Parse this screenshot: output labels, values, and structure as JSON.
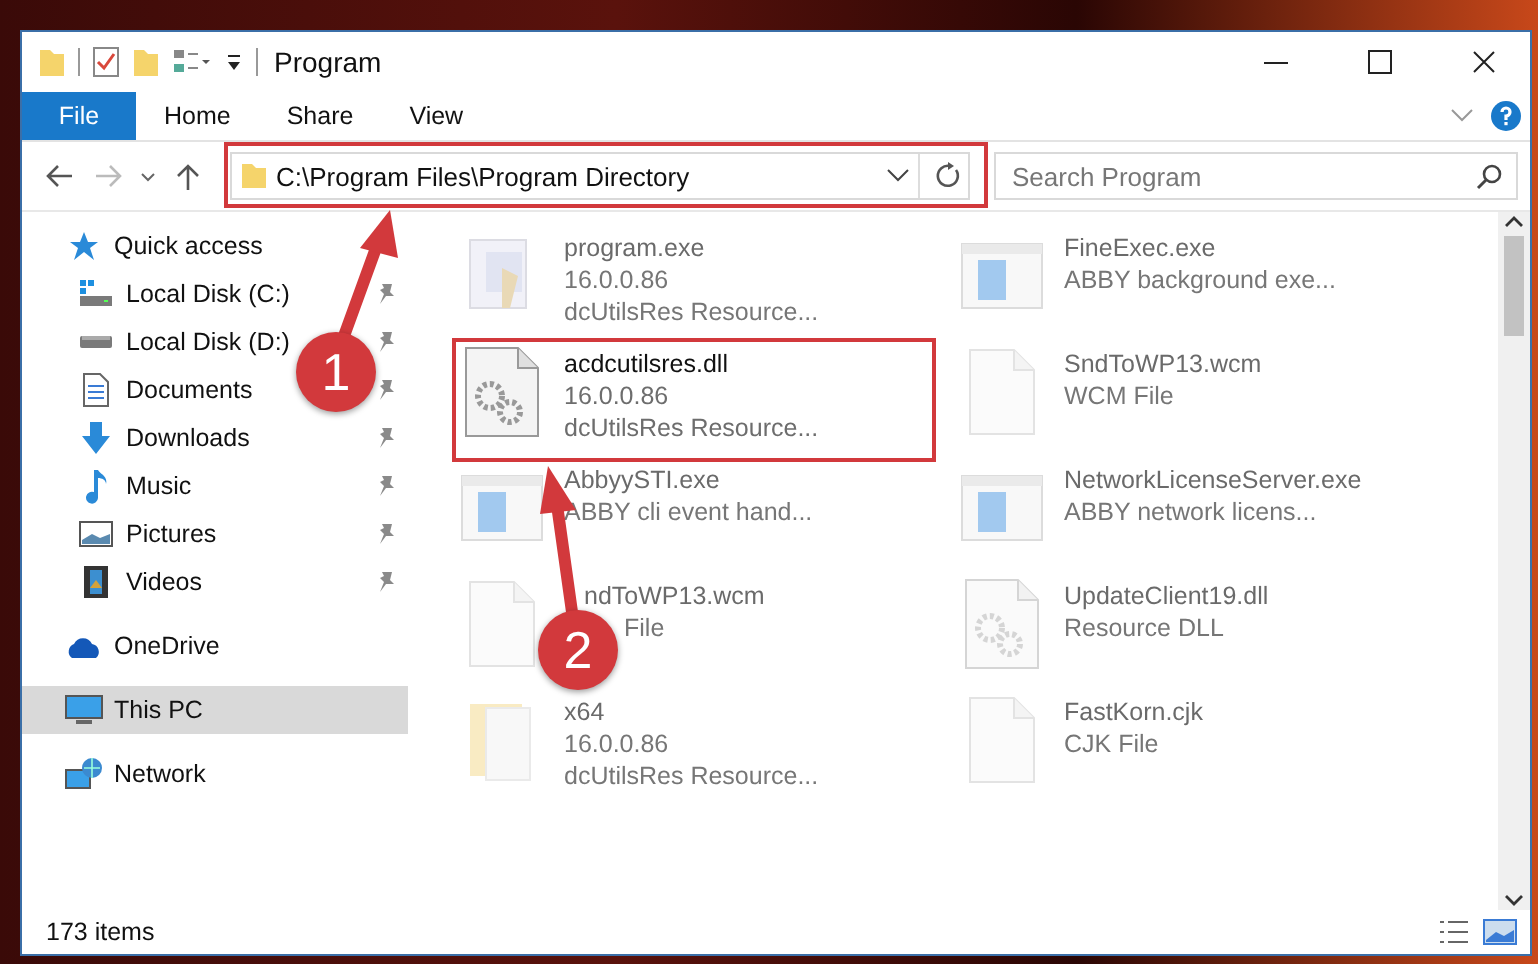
{
  "window": {
    "title": "Program"
  },
  "ribbon_tabs": [
    {
      "label": "File",
      "kind": "file"
    },
    {
      "label": "Home",
      "kind": "tab"
    },
    {
      "label": "Share",
      "kind": "tab"
    },
    {
      "label": "View",
      "kind": "tab"
    }
  ],
  "address_bar": {
    "path": "C:\\Program Files\\Program Directory"
  },
  "search": {
    "placeholder": "Search Program"
  },
  "nav": [
    {
      "label": "Quick access",
      "kind": "star",
      "selected": false,
      "children": [
        {
          "label": "Local Disk (C:)",
          "kind": "system-drive",
          "pinned": true,
          "selected": false
        },
        {
          "label": "Local Disk (D:)",
          "kind": "drive",
          "pinned": true,
          "selected": false
        },
        {
          "label": "Documents",
          "kind": "documents",
          "pinned": true,
          "selected": false
        },
        {
          "label": "Downloads",
          "kind": "downloads",
          "pinned": true,
          "selected": false
        },
        {
          "label": "Music",
          "kind": "music",
          "pinned": true,
          "selected": false
        },
        {
          "label": "Pictures",
          "kind": "pictures",
          "pinned": true,
          "selected": false
        },
        {
          "label": "Videos",
          "kind": "videos",
          "pinned": true,
          "selected": false
        }
      ]
    },
    {
      "label": "OneDrive",
      "kind": "cloud",
      "selected": false
    },
    {
      "label": "This PC",
      "kind": "computer",
      "selected": true
    },
    {
      "label": "Network",
      "kind": "network",
      "selected": false
    }
  ],
  "files": [
    {
      "name": "program.exe",
      "details": [
        "16.0.0.86",
        "dcUtilsRes Resource..."
      ],
      "kind": "installer",
      "faded": true
    },
    {
      "name": "FineExec.exe",
      "details": [
        "ABBY background exe..."
      ],
      "kind": "exe",
      "faded": true
    },
    {
      "name": "acdcutilsres.dll",
      "details": [
        "16.0.0.86",
        "dcUtilsRes Resource..."
      ],
      "kind": "dll",
      "faded": false
    },
    {
      "name": "SndToWP13.wcm",
      "details": [
        "WCM File"
      ],
      "kind": "file",
      "faded": true
    },
    {
      "name": "AbbyySTI.exe",
      "details": [
        "ABBY cli event hand..."
      ],
      "kind": "exe",
      "faded": true
    },
    {
      "name": "NetworkLicenseServer.exe",
      "details": [
        "ABBY network licens..."
      ],
      "kind": "exe",
      "faded": true
    },
    {
      "name": "ndToWP13.wcm",
      "details": [
        "File"
      ],
      "kind": "file",
      "faded": true
    },
    {
      "name": "UpdateClient19.dll",
      "details": [
        "Resource DLL"
      ],
      "kind": "dll",
      "faded": true
    },
    {
      "name": "x64",
      "details": [
        "16.0.0.86",
        "dcUtilsRes Resource..."
      ],
      "kind": "folder",
      "faded": true
    },
    {
      "name": "FastKorn.cjk",
      "details": [
        "CJK File"
      ],
      "kind": "file",
      "faded": true
    }
  ],
  "callouts": [
    {
      "label": "1"
    },
    {
      "label": "2"
    }
  ],
  "status_bar": {
    "item_count": "173 items"
  }
}
